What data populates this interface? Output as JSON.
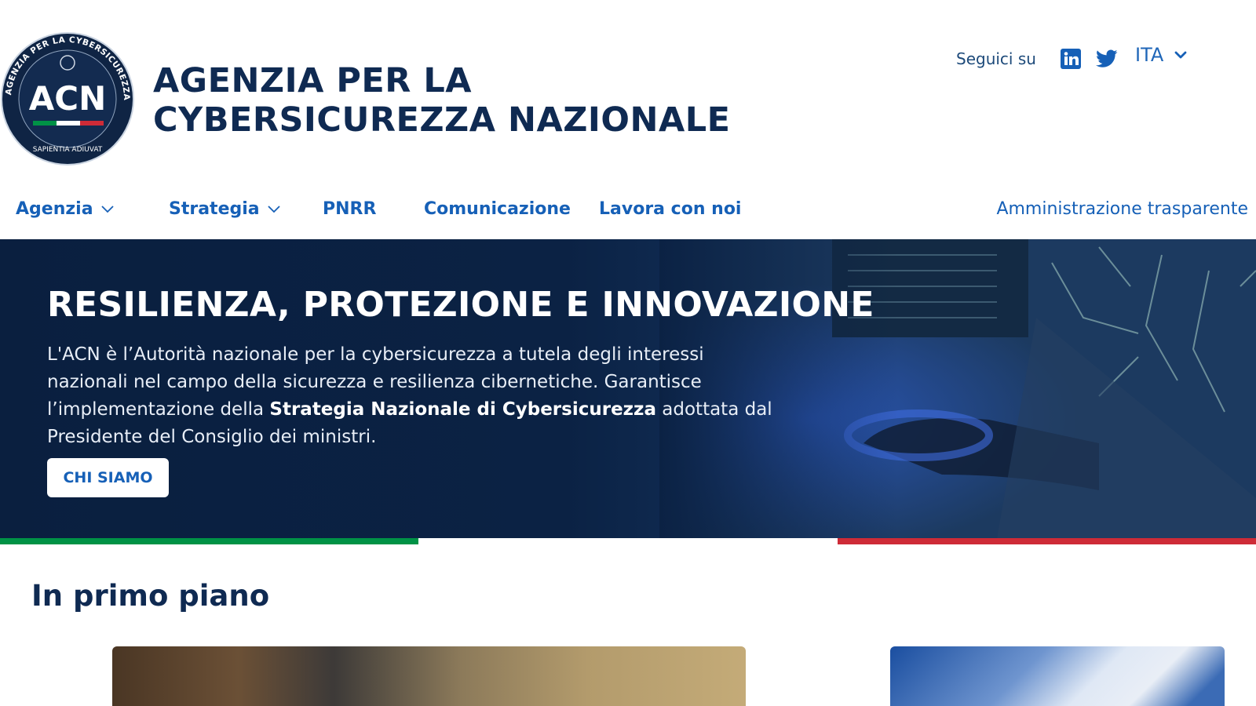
{
  "header": {
    "logo_text": "ACN",
    "logo_ring_text": "AGENZIA PER LA CYBERSICUREZZA NAZIONALE",
    "logo_motto": "SAPIENTIA ADIUVAT",
    "title_line1": "AGENZIA PER LA",
    "title_line2": "CYBERSICUREZZA NAZIONALE",
    "social_label": "Seguici su",
    "social_icons": [
      "linkedin-icon",
      "twitter-icon"
    ],
    "language": "ITA"
  },
  "nav": {
    "items": [
      {
        "label": "Agenzia",
        "has_dropdown": true
      },
      {
        "label": "Strategia",
        "has_dropdown": true
      },
      {
        "label": "PNRR",
        "has_dropdown": false
      },
      {
        "label": "Comunicazione",
        "has_dropdown": false
      },
      {
        "label": "Lavora con noi",
        "has_dropdown": false
      }
    ],
    "right_link": "Amministrazione trasparente"
  },
  "hero": {
    "title": "RESILIENZA, PROTEZIONE E INNOVAZIONE",
    "text_part1": "L'ACN è l’Autorità nazionale per la cybersicurezza a tutela degli interessi nazionali nel campo della sicurezza e resilienza cibernetiche. Garantisce l’implementazione della ",
    "text_bold": "Strategia Nazionale di Cybersicurezza",
    "text_part2": " adottata dal Presidente del Consiglio dei ministri.",
    "button_label": "CHI SIAMO"
  },
  "flag_colors": [
    "#009246",
    "#ffffff",
    "#ce2b37"
  ],
  "section": {
    "title": "In primo piano"
  },
  "colors": {
    "primary": "#1660b7",
    "dark_navy": "#0f2a52",
    "hero_bg": "#0a1f3f"
  }
}
